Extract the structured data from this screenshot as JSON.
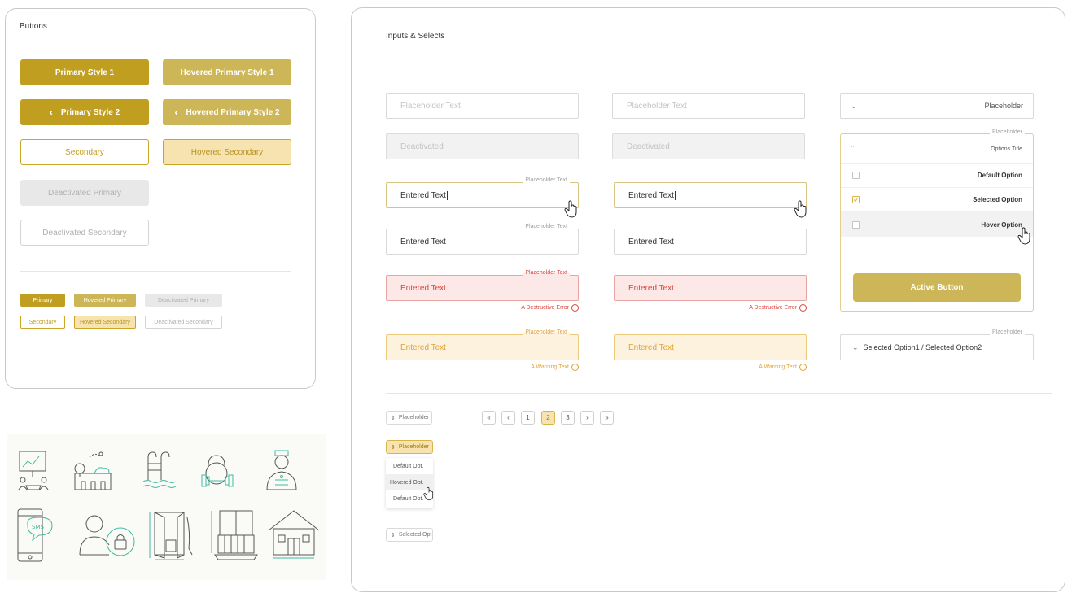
{
  "buttons_panel": {
    "title": "Buttons",
    "primary_1": "Primary Style 1",
    "hovered_primary_1": "Hovered Primary Style 1",
    "primary_2": "Primary Style 2",
    "hovered_primary_2": "Hovered Primary Style 2",
    "secondary": "Secondary",
    "hovered_secondary": "Hovered Secondary",
    "deactivated_primary": "Deactivated Primary",
    "deactivated_secondary": "Deactivated Secondary",
    "small": {
      "primary": "Primary",
      "hovered_primary": "Hovered Primary",
      "deactivated_primary": "Deactivated Primary",
      "secondary": "Secondary",
      "hovered_secondary": "Hovered Secondary",
      "deactivated_secondary": "Deactivated Secondary"
    }
  },
  "inputs_panel": {
    "title": "Inputs & Selects",
    "col1": {
      "placeholder": "Placeholder Text",
      "deactivated": "Deactivated",
      "active_label": "Placeholder Text",
      "active_value": "Entered Text",
      "filled_label": "Placeholder Text",
      "filled_value": "Entered Text",
      "error_label": "Placeholder Text",
      "error_value": "Entered Text",
      "error_hint": "A Destructive Error",
      "warn_label": "Placeholder Text",
      "warn_value": "Entered Text",
      "warn_hint": "A Warning Text"
    },
    "col2": {
      "placeholder": "Placeholder Text",
      "deactivated": "Deactivated",
      "active_value": "Entered Text",
      "filled_value": "Entered Text",
      "error_value": "Entered Text",
      "error_hint": "A Destructive Error",
      "warn_value": "Entered Text",
      "warn_hint": "A Warning Text"
    },
    "select_closed": {
      "placeholder": "Placeholder"
    },
    "select_open": {
      "label": "Placeholder",
      "title": "Options Title",
      "options": [
        {
          "label": "Default Option",
          "checked": false
        },
        {
          "label": "Selected Option",
          "checked": true
        },
        {
          "label": "Hover Option",
          "checked": false
        }
      ],
      "action": "Active Button"
    },
    "select_multi": {
      "label": "Placeholder",
      "value": "Selected Option1 / Selected Option2"
    },
    "mini_select": {
      "placeholder": "Placeholder",
      "active": "Placeholder",
      "options": [
        "Default Opt.",
        "Hovered Opt.",
        "Default Opt."
      ],
      "selected": "Selected Opt"
    },
    "pagination": {
      "pages": [
        "1",
        "2",
        "3"
      ],
      "current": "2",
      "first": "«",
      "prev": "‹",
      "next": "›",
      "last": "»"
    }
  },
  "colors": {
    "primary": "#c09e20",
    "primary_hover": "#cdb658",
    "secondary_hover_bg": "#f6e3b0",
    "error": "#d9463e",
    "warning": "#e0a23a",
    "icon_teal": "#3fb9a0"
  },
  "icons": [
    "presentation-icon",
    "house-tree-icon",
    "pool-ladder-icon",
    "kettlebell-dumbbell-icon",
    "staff-member-icon",
    "sms-phone-icon",
    "user-lock-icon",
    "open-door-icon",
    "balcony-icon",
    "house-icon"
  ]
}
